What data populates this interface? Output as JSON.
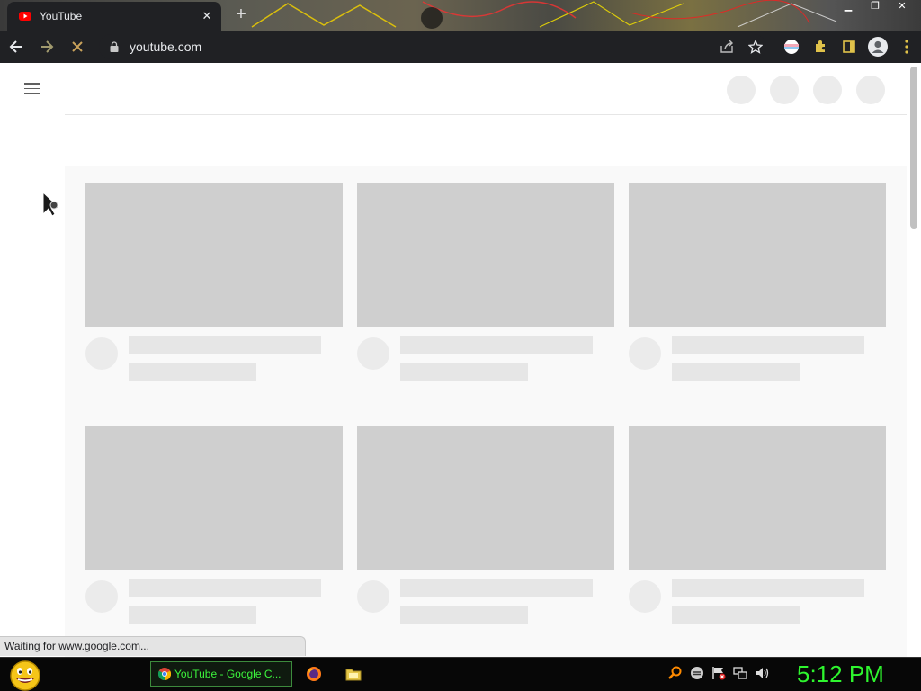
{
  "browser": {
    "tab": {
      "title": "YouTube",
      "close_icon": "close-icon",
      "favicon": "youtube-favicon"
    },
    "new_tab_icon": "plus-icon",
    "window_controls": [
      "minimize-icon",
      "restore-icon",
      "close-icon"
    ],
    "toolbar": {
      "back_icon": "arrow-left-icon",
      "forward_icon": "arrow-right-icon",
      "stop_icon": "stop-loading-icon",
      "url": "youtube.com",
      "lock_icon": "lock-icon",
      "right_icons": [
        "share-icon",
        "star-icon",
        "extension-flag-icon",
        "puzzle-icon",
        "sidepanel-icon",
        "profile-icon",
        "more-vert-icon"
      ]
    },
    "status_text": "Waiting for www.google.com..."
  },
  "page": {
    "grid": {
      "columns": 3,
      "rows_visible": 2
    }
  },
  "taskbar": {
    "active_task_label": "YouTube - Google C...",
    "quick_launch": [
      "firefox-icon",
      "folder-icon"
    ],
    "tray_icons": [
      "search-icon",
      "messenger-icon",
      "flag-icon",
      "network-icon",
      "volume-icon"
    ],
    "clock": "5:12 PM"
  },
  "colors": {
    "chrome_dark": "#202124",
    "skeleton_thumb": "#cfcfcf",
    "skeleton_line": "#e6e6e6",
    "taskbar_green": "#2ef52e",
    "youtube_red": "#ff0000"
  }
}
